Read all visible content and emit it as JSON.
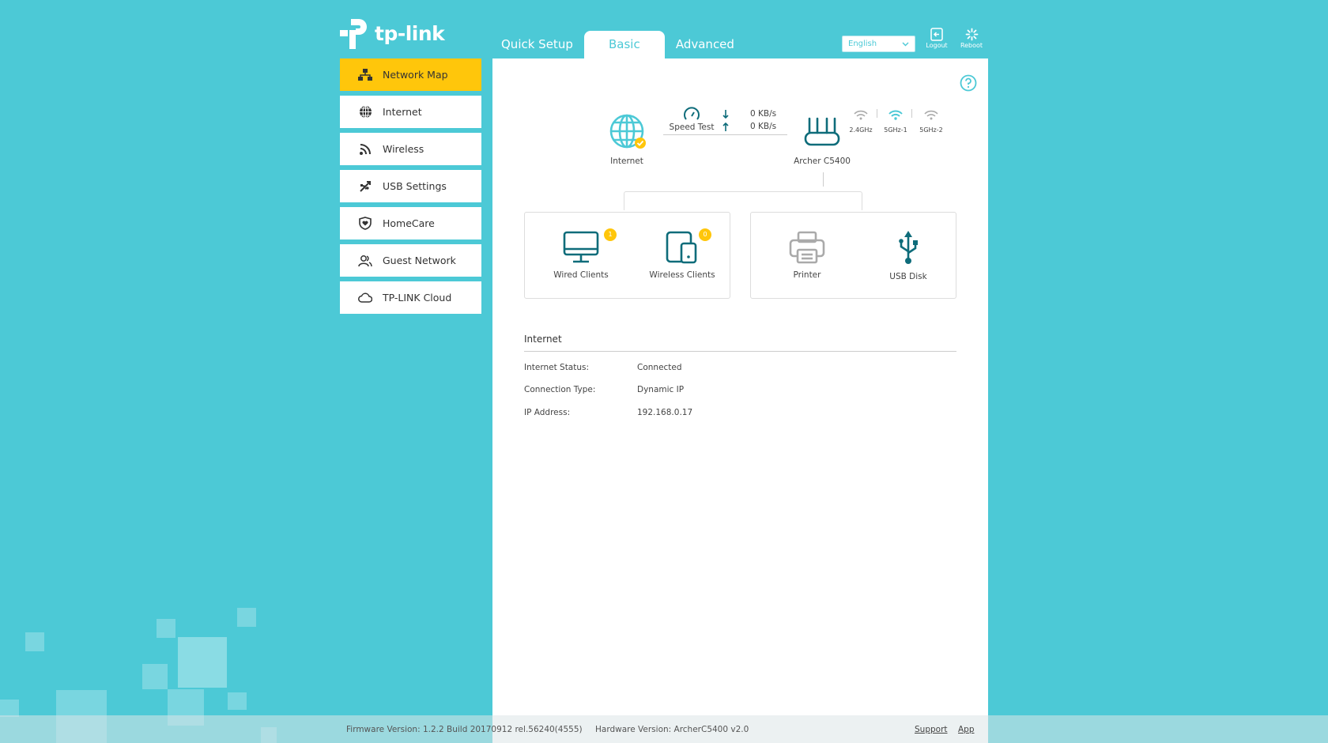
{
  "brand": {
    "logo_text": "tp-link"
  },
  "tabs": [
    {
      "label": "Quick Setup"
    },
    {
      "label": "Basic"
    },
    {
      "label": "Advanced"
    }
  ],
  "top": {
    "language": "English",
    "logout_label": "Logout",
    "reboot_label": "Reboot"
  },
  "sidebar": {
    "items": [
      {
        "label": "Network Map",
        "icon": "network-map-icon"
      },
      {
        "label": "Internet",
        "icon": "globe-icon"
      },
      {
        "label": "Wireless",
        "icon": "wifi-icon"
      },
      {
        "label": "USB Settings",
        "icon": "usb-icon"
      },
      {
        "label": "HomeCare",
        "icon": "shield-icon"
      },
      {
        "label": "Guest Network",
        "icon": "guests-icon"
      },
      {
        "label": "TP-LINK Cloud",
        "icon": "cloud-icon"
      }
    ]
  },
  "map": {
    "internet_label": "Internet",
    "speed_test_label": "Speed Test",
    "download": "0 KB/s",
    "upload": "0 KB/s",
    "router_label": "Archer C5400",
    "bands": [
      "2.4GHz",
      "5GHz-1",
      "5GHz-2"
    ],
    "wired_clients_label": "Wired Clients",
    "wired_clients_count": "1",
    "wireless_clients_label": "Wireless Clients",
    "wireless_clients_count": "0",
    "printer_label": "Printer",
    "usb_disk_label": "USB Disk"
  },
  "info": {
    "title": "Internet",
    "rows": [
      {
        "key": "Internet Status:",
        "value": "Connected"
      },
      {
        "key": "Connection Type:",
        "value": "Dynamic IP"
      },
      {
        "key": "IP Address:",
        "value": "192.168.0.17"
      }
    ]
  },
  "footer": {
    "firmware": "Firmware Version: 1.2.2 Build 20170912 rel.56240(4555)",
    "hardware": "Hardware Version: ArcherC5400 v2.0",
    "support_label": "Support",
    "app_label": "App"
  },
  "colors": {
    "background": "#4cc9d6",
    "accent": "#ffc60b",
    "icon_dark": "#0e6c7a"
  }
}
